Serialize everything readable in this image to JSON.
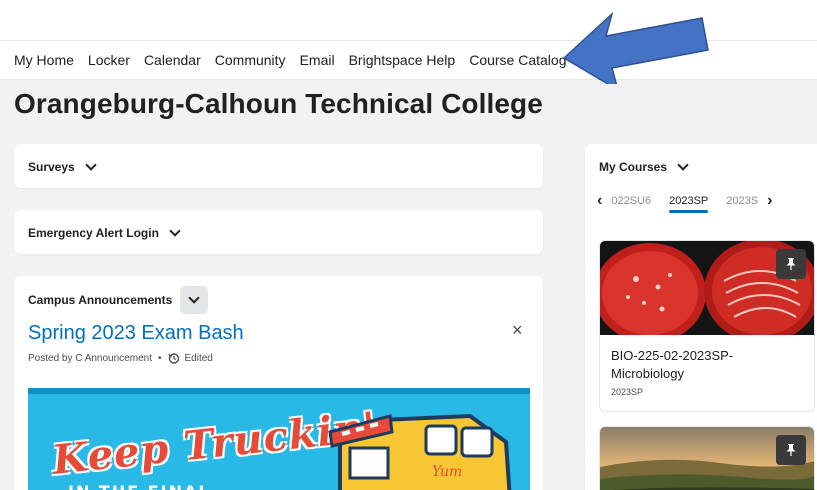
{
  "nav": {
    "items": [
      "My Home",
      "Locker",
      "Calendar",
      "Community",
      "Email",
      "Brightspace Help",
      "Course Catalog"
    ]
  },
  "page": {
    "title": "Orangeburg-Calhoun Technical College"
  },
  "widgets": {
    "surveys": "Surveys",
    "emergency": "Emergency Alert Login",
    "announcements": {
      "heading": "Campus Announcements",
      "title": "Spring 2023 Exam Bash",
      "posted_by": "Posted by C Announcement",
      "edited": "Edited",
      "close_glyph": "×",
      "image_text": "Keep Truckin'",
      "image_subtext": "IN THE FINAL",
      "truck_sign": "Yum"
    }
  },
  "my_courses": {
    "heading": "My Courses",
    "tabs": [
      "022SU6",
      "2023SP",
      "2023S"
    ],
    "active_tab": "2023SP",
    "courses": [
      {
        "name": "BIO-225-02-2023SP-Microbiology",
        "term": "2023SP",
        "image": "petri-dish-bacteria"
      },
      {
        "name": "",
        "term": "",
        "image": "vineyard-landscape"
      }
    ]
  },
  "colors": {
    "link": "#006fbf",
    "arrow": "#4472c4",
    "banner": "#28b9e6",
    "background": "#f1f2f4"
  },
  "icons": [
    "chevron-down-icon",
    "close-icon",
    "history-icon",
    "pin-icon",
    "chevron-left-icon",
    "chevron-right-icon",
    "arrow-annotation"
  ]
}
